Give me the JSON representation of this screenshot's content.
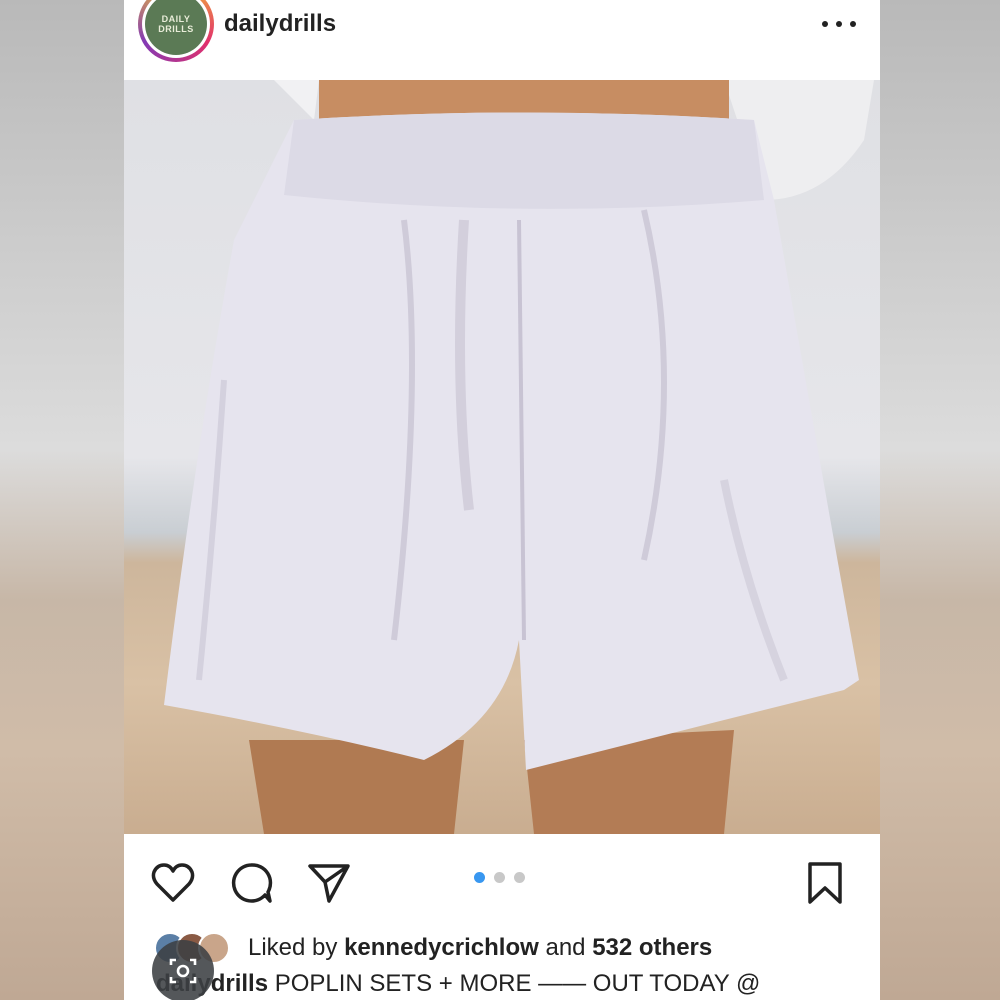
{
  "post": {
    "username": "dailydrills",
    "avatar_text_line1": "DAILY",
    "avatar_text_line2": "DRILLS",
    "more_icon": "more-horizontal-icon"
  },
  "photo": {
    "subject_icon": "product-photo"
  },
  "actions": {
    "like_icon": "heart-icon",
    "comment_icon": "comment-bubble-icon",
    "share_icon": "send-paper-plane-icon",
    "save_icon": "bookmark-icon",
    "carousel_dots": 3,
    "carousel_active_index": 0,
    "accent_color": "#3897f0"
  },
  "likes": {
    "prefix": "Liked by ",
    "user": "kennedycrichlow",
    "middle": " and ",
    "count_text": "532 others"
  },
  "caption": {
    "username": "dailydrills",
    "text": " POPLIN SETS + MORE —— OUT TODAY @"
  },
  "overlay": {
    "lens_icon": "lens-camera-icon"
  }
}
